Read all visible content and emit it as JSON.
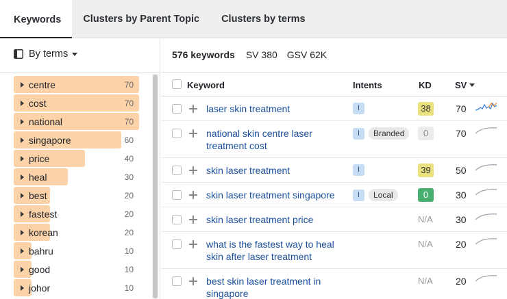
{
  "tabs": [
    "Keywords",
    "Clusters by Parent Topic",
    "Clusters by terms"
  ],
  "left": {
    "group_by_label": "By terms",
    "terms": [
      {
        "label": "centre",
        "count": "70",
        "share": 1.0
      },
      {
        "label": "cost",
        "count": "70",
        "share": 1.0
      },
      {
        "label": "national",
        "count": "70",
        "share": 1.0
      },
      {
        "label": "singapore",
        "count": "60",
        "share": 0.86
      },
      {
        "label": "price",
        "count": "40",
        "share": 0.57
      },
      {
        "label": "heal",
        "count": "30",
        "share": 0.43
      },
      {
        "label": "best",
        "count": "20",
        "share": 0.29
      },
      {
        "label": "fastest",
        "count": "20",
        "share": 0.29
      },
      {
        "label": "korean",
        "count": "20",
        "share": 0.29
      },
      {
        "label": "bahru",
        "count": "10",
        "share": 0.14
      },
      {
        "label": "good",
        "count": "10",
        "share": 0.14
      },
      {
        "label": "johor",
        "count": "10",
        "share": 0.14
      }
    ]
  },
  "summary": {
    "keywords": "576 keywords",
    "sv": "SV 380",
    "gsv": "GSV 62K"
  },
  "table": {
    "headers": {
      "keyword": "Keyword",
      "intents": "Intents",
      "kd": "KD",
      "sv": "SV"
    },
    "rows": [
      {
        "keyword_line1": "laser skin treatment",
        "keyword_line2": "",
        "intents": [
          "I"
        ],
        "kd": "38",
        "kd_color": "yellow",
        "sv": "70"
      },
      {
        "keyword_line1": "national skin centre laser",
        "keyword_line2": "treatment cost",
        "intents": [
          "I",
          "Branded"
        ],
        "kd": "0",
        "kd_color": "grey",
        "sv": "70"
      },
      {
        "keyword_line1": "skin laser treatment",
        "keyword_line2": "",
        "intents": [
          "I"
        ],
        "kd": "39",
        "kd_color": "yellow",
        "sv": "50"
      },
      {
        "keyword_line1": "skin laser treatment singapore",
        "keyword_line2": "",
        "intents": [
          "I",
          "Local"
        ],
        "kd": "0",
        "kd_color": "green",
        "sv": "30"
      },
      {
        "keyword_line1": "skin laser treatment price",
        "keyword_line2": "",
        "intents": [],
        "kd": "N/A",
        "kd_color": "na",
        "sv": "30"
      },
      {
        "keyword_line1": "what is the fastest way to heal",
        "keyword_line2": "skin after laser treatment",
        "intents": [],
        "kd": "N/A",
        "kd_color": "na",
        "sv": "20"
      },
      {
        "keyword_line1": "best skin laser treatment in",
        "keyword_line2": "singapore",
        "intents": [],
        "kd": "N/A",
        "kd_color": "na",
        "sv": "20"
      }
    ]
  },
  "colors": {
    "term_bar": "#fcd2a8",
    "link": "#1a4f9c",
    "intent_badge": "#c6dcf3",
    "kd_yellow": "#e9e07e",
    "kd_green": "#48b071"
  }
}
